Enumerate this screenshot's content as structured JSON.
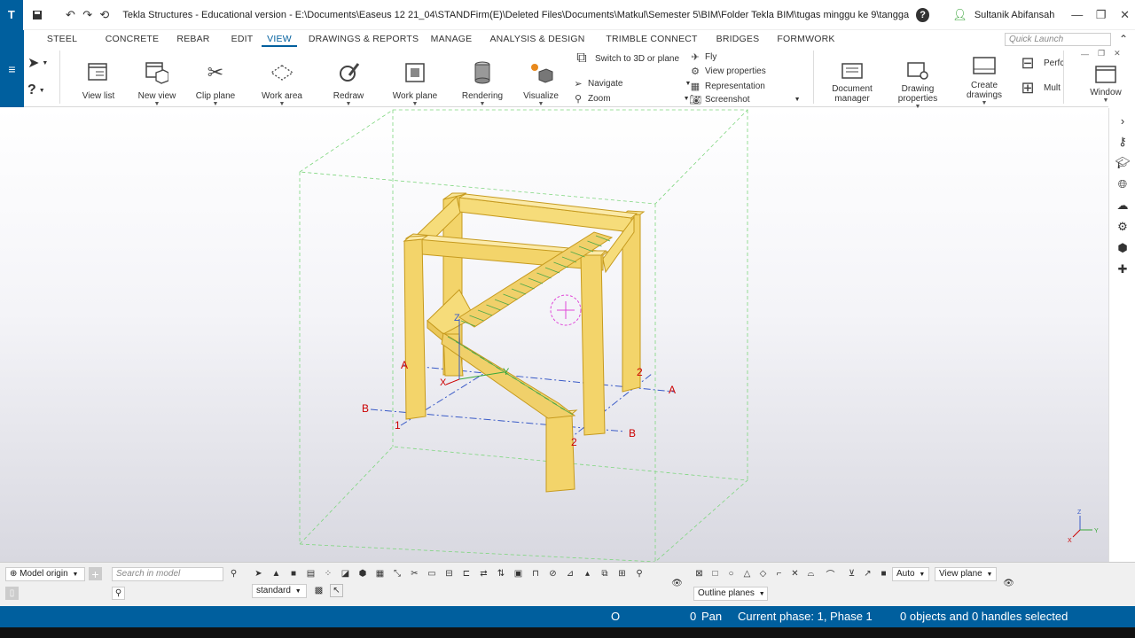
{
  "titlebar": {
    "logo": "T",
    "title": "Tekla Structures - Educational version - E:\\Documents\\Easeus 12 21_04\\STANDFirm(E)\\Deleted Files\\Documents\\Matkul\\Semester 5\\BIM\\Folder Tekla BIM\\tugas minggu ke 9\\tangga tutor video\\tangga tut...",
    "help": "?",
    "user": "Sultanik Abifansah",
    "icons": [
      "save-icon",
      "undo-icon",
      "redo-icon",
      "history-icon"
    ]
  },
  "tabs": [
    "STEEL",
    "CONCRETE",
    "REBAR",
    "EDIT",
    "VIEW",
    "DRAWINGS & REPORTS",
    "MANAGE",
    "ANALYSIS & DESIGN",
    "TRIMBLE CONNECT",
    "BRIDGES",
    "FORMWORK"
  ],
  "active_tab": "VIEW",
  "quick_launch": "Quick Launch",
  "ribbon": {
    "view_list": "View list",
    "new_view": "New view",
    "clip_plane": "Clip plane",
    "work_area": "Work area",
    "redraw": "Redraw",
    "work_plane": "Work plane",
    "rendering": "Rendering",
    "visualize": "Visualize",
    "switch_3d": "Switch to 3D or plane",
    "navigate": "Navigate",
    "zoom": "Zoom",
    "fly": "Fly",
    "view_properties": "View properties",
    "representation": "Representation",
    "screenshot": "Screenshot",
    "document_manager_1": "Document",
    "document_manager_2": "manager",
    "drawing_properties_1": "Drawing",
    "drawing_properties_2": "properties",
    "create_drawings_1": "Create",
    "create_drawings_2": "drawings",
    "perf": "Perfc",
    "mult": "Mult",
    "window": "Window"
  },
  "model_labels": {
    "grid_a": "A",
    "grid_b": "B",
    "grid_1": "1",
    "grid_2": "2",
    "axis_x": "X",
    "axis_y": "Y",
    "axis_z": "Z"
  },
  "bottom": {
    "model_origin": "Model origin",
    "search_placeholder": "Search in model",
    "standard": "standard",
    "auto": "Auto",
    "view_plane": "View plane",
    "outline_planes": "Outline planes"
  },
  "status": {
    "o": "O",
    "zero": "0",
    "pan": "Pan",
    "phase": "Current phase: 1, Phase 1",
    "selection": "0 objects and 0 handles selected"
  },
  "colors": {
    "brand_blue": "#005f9e",
    "member_fill": "#f3d46a",
    "member_edge": "#c69a1e",
    "work_area_green": "#7ed67e",
    "grid_red": "#cc0000",
    "grid_blue": "#3a5bc7"
  }
}
